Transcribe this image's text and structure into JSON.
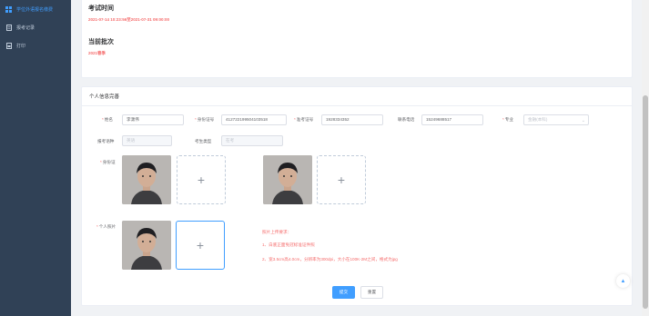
{
  "sidebar": {
    "items": [
      {
        "label": "学位外语报名缴费",
        "icon": "grid-icon",
        "active": true
      },
      {
        "label": "报考记录",
        "icon": "document-icon",
        "active": false
      },
      {
        "label": "打印",
        "icon": "print-icon",
        "active": false
      }
    ]
  },
  "exam": {
    "time_title": "考试时间",
    "time_value": "2021-07-14 10:23:56至2021-07-31 09:00:00",
    "batch_title": "当前批次",
    "batch_value": "2021春季"
  },
  "form": {
    "section_title": "个人信息完善",
    "fields": {
      "name": {
        "label": "姓名",
        "value": "李潇伟",
        "required": true
      },
      "id_number": {
        "label": "身份证号",
        "value": "412722199504103518",
        "required": true
      },
      "exam_number": {
        "label": "准考证号",
        "value": "1928334352",
        "required": true
      },
      "phone": {
        "label": "联系电话",
        "value": "15249688517",
        "required": false
      },
      "major": {
        "label": "专业",
        "placeholder": "金融(本科)",
        "required": true
      },
      "language": {
        "label": "报考语种",
        "placeholder": "英语",
        "required": false
      },
      "candidate_type": {
        "label": "考生类型",
        "placeholder": "在考",
        "required": false
      }
    },
    "id_card_label": "身份证",
    "photo_label": "个人照片",
    "upload_plus": "+",
    "requirements": {
      "title": "照片上传要求：",
      "line1": "1、白底正面免冠标准证件照",
      "line2": "2、宽3.5cm高4.0cm，分辨率为300dpi，大小在100K-2M之间，格式为jpg"
    },
    "submit_label": "提交",
    "reset_label": "重置"
  },
  "back_to_top": "▲",
  "colors": {
    "sidebar_bg": "#304156",
    "accent": "#409eff",
    "danger": "#f56c6c"
  }
}
